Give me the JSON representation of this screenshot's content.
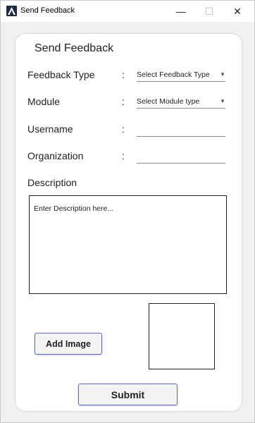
{
  "window": {
    "title": "Send Feedback",
    "icon": "app-logo-icon",
    "controls": {
      "minimize": "—",
      "maximize": "☐",
      "close": "✕"
    }
  },
  "form": {
    "heading": "Send Feedback",
    "colon": ":",
    "feedback_type": {
      "label": "Feedback Type",
      "selected": "Select Feedback Type"
    },
    "module": {
      "label": "Module",
      "selected": "Select Module type"
    },
    "username": {
      "label": "Username",
      "value": ""
    },
    "organization": {
      "label": "Organization",
      "value": ""
    },
    "description": {
      "label": "Description",
      "placeholder": "Enter Description here..."
    },
    "add_image_label": "Add Image",
    "submit_label": "Submit"
  },
  "colors": {
    "button_border": "#5b6fb4",
    "card_background": "#ffffff",
    "window_background": "#f1f1f1"
  }
}
